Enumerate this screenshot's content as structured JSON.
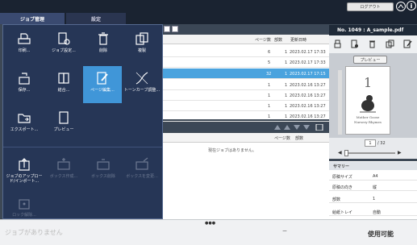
{
  "header": {
    "tabs": [
      "ジョブ管理",
      "設定"
    ],
    "logout_label": "ログアウト",
    "info_icon": "i"
  },
  "job_menu": {
    "items": [
      {
        "label": "印刷...",
        "icon": "print-icon"
      },
      {
        "label": "ジョブ設定...",
        "icon": "job-settings-icon"
      },
      {
        "label": "削除",
        "icon": "trash-icon"
      },
      {
        "label": "複製",
        "icon": "duplicate-icon"
      },
      {
        "label": "保存...",
        "icon": "save-icon"
      },
      {
        "label": "結合...",
        "icon": "merge-icon"
      },
      {
        "label": "ページ編集...",
        "icon": "page-edit-icon"
      },
      {
        "label": "トーンカーブ調整...",
        "icon": "tone-curve-icon"
      },
      {
        "label": "エクスポート...",
        "icon": "export-icon"
      },
      {
        "label": "プレビュー",
        "icon": "preview-icon"
      },
      {
        "label": "ジョブのアップロード/インポート...",
        "icon": "upload-icon"
      },
      {
        "label": "ボックス作成...",
        "icon": "box-create-icon"
      },
      {
        "label": "ボックス削除",
        "icon": "box-delete-icon"
      },
      {
        "label": "ボックスを変更...",
        "icon": "box-change-icon"
      },
      {
        "label": "ロック解除...",
        "icon": "unlock-icon"
      }
    ]
  },
  "job_list": {
    "columns": [
      "ページ数",
      "部数",
      "更新日時"
    ],
    "rows": [
      {
        "pages": "6",
        "copies": "1",
        "date": "2023.02.17 17:33"
      },
      {
        "pages": "5",
        "copies": "1",
        "date": "2023.02.17 17:33"
      },
      {
        "pages": "32",
        "copies": "1",
        "date": "2023.02.17 17:15"
      },
      {
        "pages": "1",
        "copies": "1",
        "date": "2023.02.16 13:27"
      },
      {
        "pages": "1",
        "copies": "1",
        "date": "2023.02.16 13:27"
      },
      {
        "pages": "1",
        "copies": "1",
        "date": "2023.02.16 13:27"
      },
      {
        "pages": "1",
        "copies": "1",
        "date": "2023.02.16 13:27"
      }
    ]
  },
  "queue": {
    "columns": [
      "ページ数",
      "部数"
    ],
    "empty_text": "現在ジョブはありません。"
  },
  "right_panel": {
    "title": "No. 1049 : A_sample.pdf",
    "preview_label": "プレビュー",
    "page_current": "1",
    "page_total": "/ 32",
    "thumb": {
      "big_number": "1",
      "line1": "Mother Goose",
      "line2": "Nursery Rhymes"
    },
    "summary_title": "サマリー",
    "summary": [
      {
        "key": "原稿サイズ",
        "value": "A4"
      },
      {
        "key": "原稿の向き",
        "value": "縦"
      },
      {
        "key": "部数",
        "value": "1"
      },
      {
        "key": "給紙トレイ",
        "value": "自動"
      }
    ]
  },
  "status": {
    "left_text": "ジョブがありません",
    "dots": "●●●",
    "dash": "ー",
    "right_text": "使用可能"
  },
  "colors": {
    "accent": "#4aa3de",
    "menu_bg": "#263656",
    "selected_menu": "#4096d8"
  }
}
